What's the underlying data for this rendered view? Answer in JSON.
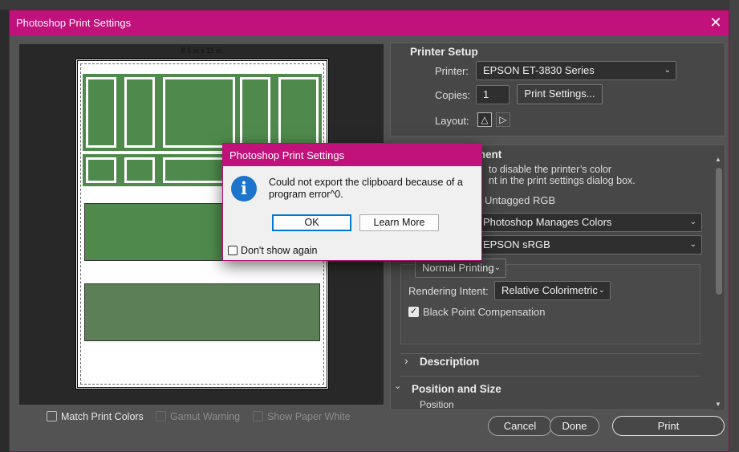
{
  "window": {
    "title": "Photoshop Print Settings",
    "close_glyph": "✕"
  },
  "preview": {
    "paper_size": "8.5 in x 11 in",
    "match_print_colors": "Match Print Colors",
    "gamut_warning": "Gamut Warning",
    "show_paper_white": "Show Paper White"
  },
  "printer_setup": {
    "title": "Printer Setup",
    "printer_label": "Printer:",
    "printer_value": "EPSON ET-3830 Series",
    "copies_label": "Copies:",
    "copies_value": "1",
    "print_settings_button": "Print Settings...",
    "layout_label": "Layout:"
  },
  "color_management": {
    "title_partial": "ment",
    "hint_line1": "to disable the printer’s color",
    "hint_line2": "nt in the print settings dialog box.",
    "document_profile": "Untagged RGB",
    "color_handling": "Photoshop Manages Colors",
    "printer_profile": "EPSON  sRGB",
    "normal_printing": "Normal Printing",
    "rendering_intent_label": "Rendering Intent:",
    "rendering_intent_value": "Relative Colorimetric",
    "black_point_label": "Black Point Compensation"
  },
  "sections": {
    "description": "Description",
    "position_and_size": "Position and Size",
    "position": "Position"
  },
  "footer": {
    "cancel": "Cancel",
    "done": "Done",
    "print": "Print"
  },
  "modal": {
    "title": "Photoshop Print Settings",
    "message": "Could not export the clipboard because of a program error^0.",
    "ok": "OK",
    "learn_more": "Learn More",
    "dont_show_again": "Don't show again",
    "icon": "info-icon"
  },
  "colors": {
    "titlebar": "#c1117a",
    "dialog_bg": "#535353",
    "preview_green": "#4f8a4c",
    "info_blue": "#1c74cc"
  }
}
